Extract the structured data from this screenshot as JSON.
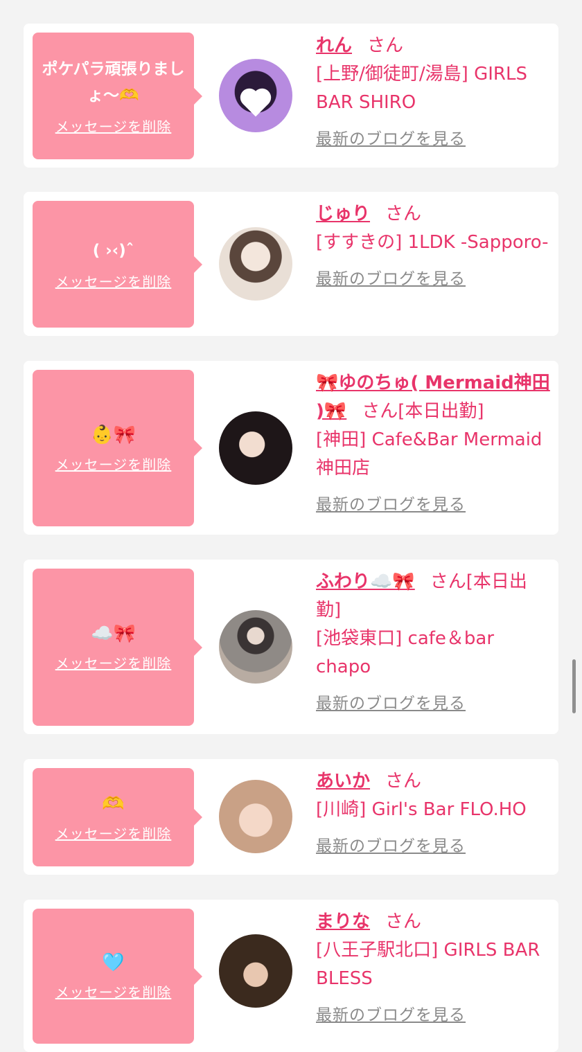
{
  "colors": {
    "background": "#f3f3f3",
    "bubble": "#fc95a6",
    "accent": "#e8346a",
    "link_gray": "#8a8a8a"
  },
  "delete_label": "メッセージを削除",
  "blog_label": "最新のブログを見る",
  "honorific": "さん",
  "items": [
    {
      "message": "ポケパラ頑張りましょ〜🫶",
      "name": "れん",
      "status": "",
      "shop": "[上野/御徒町/湯島] GIRLS BAR SHIRO",
      "avatar_icon": "profile-photo-icon"
    },
    {
      "message": "( ›‹)ˆ",
      "name": "じゅり",
      "status": "",
      "shop": "[すすきの] 1LDK -Sapporo-",
      "avatar_icon": "profile-photo-icon"
    },
    {
      "message": "👶🎀",
      "name": "🎀ゆのちゅ( Mermaid神田 )🎀",
      "status": "[本日出勤]",
      "shop": "[神田] Cafe&Bar Mermaid 神田店",
      "avatar_icon": "profile-photo-icon"
    },
    {
      "message": "☁️🎀",
      "name": "ふわり☁️🎀",
      "status": "[本日出勤]",
      "shop": "[池袋東口] cafe＆bar chapo",
      "avatar_icon": "profile-photo-icon"
    },
    {
      "message": "🫶",
      "name": "あいか",
      "status": "",
      "shop": "[川崎] Girl's Bar FLO.HO",
      "avatar_icon": "profile-photo-icon"
    },
    {
      "message": "🩵",
      "name": "まりな",
      "status": "",
      "shop": "[八王子駅北口] GIRLS BAR BLESS",
      "avatar_icon": "profile-photo-icon"
    }
  ]
}
